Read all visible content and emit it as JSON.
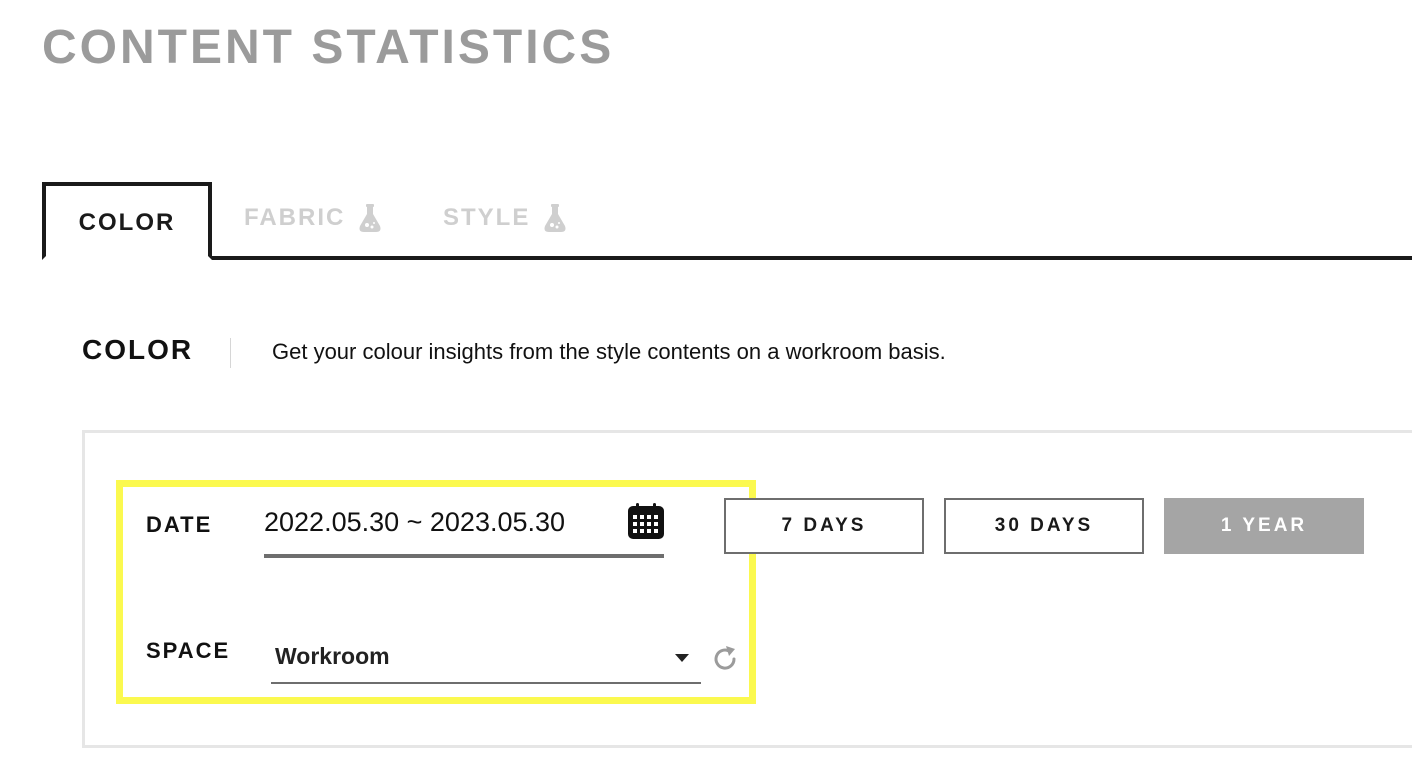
{
  "page": {
    "title": "CONTENT STATISTICS"
  },
  "tabs": [
    {
      "label": "COLOR",
      "active": true,
      "icon": ""
    },
    {
      "label": "FABRIC",
      "active": false,
      "icon": "flask-icon"
    },
    {
      "label": "STYLE",
      "active": false,
      "icon": "flask-icon"
    }
  ],
  "section": {
    "title": "COLOR",
    "description": "Get your colour insights from the style contents on a workroom basis."
  },
  "filters": {
    "date_label": "DATE",
    "date_range": "2022.05.30 ~ 2023.05.30",
    "date_icon": "calendar-icon",
    "period_buttons": [
      {
        "label": "7 DAYS",
        "selected": false
      },
      {
        "label": "30 DAYS",
        "selected": false
      },
      {
        "label": "1 YEAR",
        "selected": true
      }
    ],
    "space_label": "SPACE",
    "space_value": "Workroom",
    "space_icon": "refresh-icon"
  },
  "colors": {
    "title_gray": "#9b9b9b",
    "tab_border": "#1a1a1a",
    "inactive_tab": "#cfcfcf",
    "highlight": "#fbf94f",
    "selected_button": "#a5a5a5"
  }
}
